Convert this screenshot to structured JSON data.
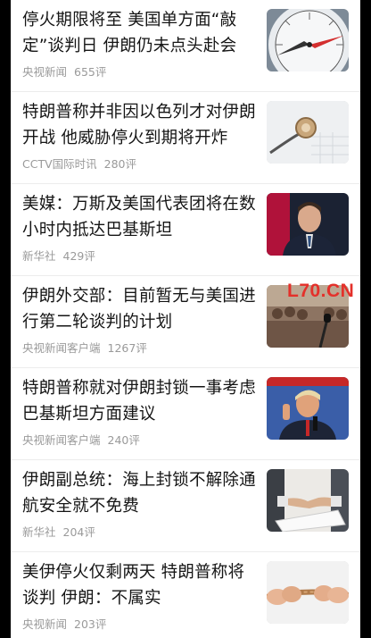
{
  "feed": {
    "items": [
      {
        "title": "停火期限将至 美国单方面“敲定”谈判日 伊朗仍未点头赴会",
        "source": "央视新闻",
        "comments": "655评",
        "thumb_icon": "compass-photo-icon"
      },
      {
        "title": "特朗普称并非因以色列才对伊朗开战 他威胁停火到期将开炸",
        "source": "CCTV国际时讯",
        "comments": "280评",
        "thumb_icon": "stethoscope-photo-icon"
      },
      {
        "title": "美媒：万斯及美国代表团将在数小时内抵达巴基斯坦",
        "source": "新华社",
        "comments": "429评",
        "thumb_icon": "politician-portrait-icon"
      },
      {
        "title": "伊朗外交部：目前暂无与美国进行第二轮谈判的计划",
        "source": "央视新闻客户端",
        "comments": "1267评",
        "thumb_icon": "press-conference-photo-icon"
      },
      {
        "title": "特朗普称就对伊朗封锁一事考虑巴基斯坦方面建议",
        "source": "央视新闻客户端",
        "comments": "240评",
        "thumb_icon": "trump-speaking-photo-icon"
      },
      {
        "title": "伊朗副总统：海上封锁不解除通航安全就不免费",
        "source": "新华社",
        "comments": "204评",
        "thumb_icon": "handshake-document-photo-icon"
      },
      {
        "title": "美伊停火仅剩两天 特朗普称将谈判 伊朗：不属实",
        "source": "央视新闻",
        "comments": "203评",
        "thumb_icon": "tug-of-war-rope-photo-icon"
      }
    ]
  },
  "watermark": "L70.CN",
  "colors": {
    "background": "#000000",
    "card": "#ffffff",
    "title": "#151515",
    "meta": "#9a9a9a",
    "watermark": "#e4302a"
  }
}
